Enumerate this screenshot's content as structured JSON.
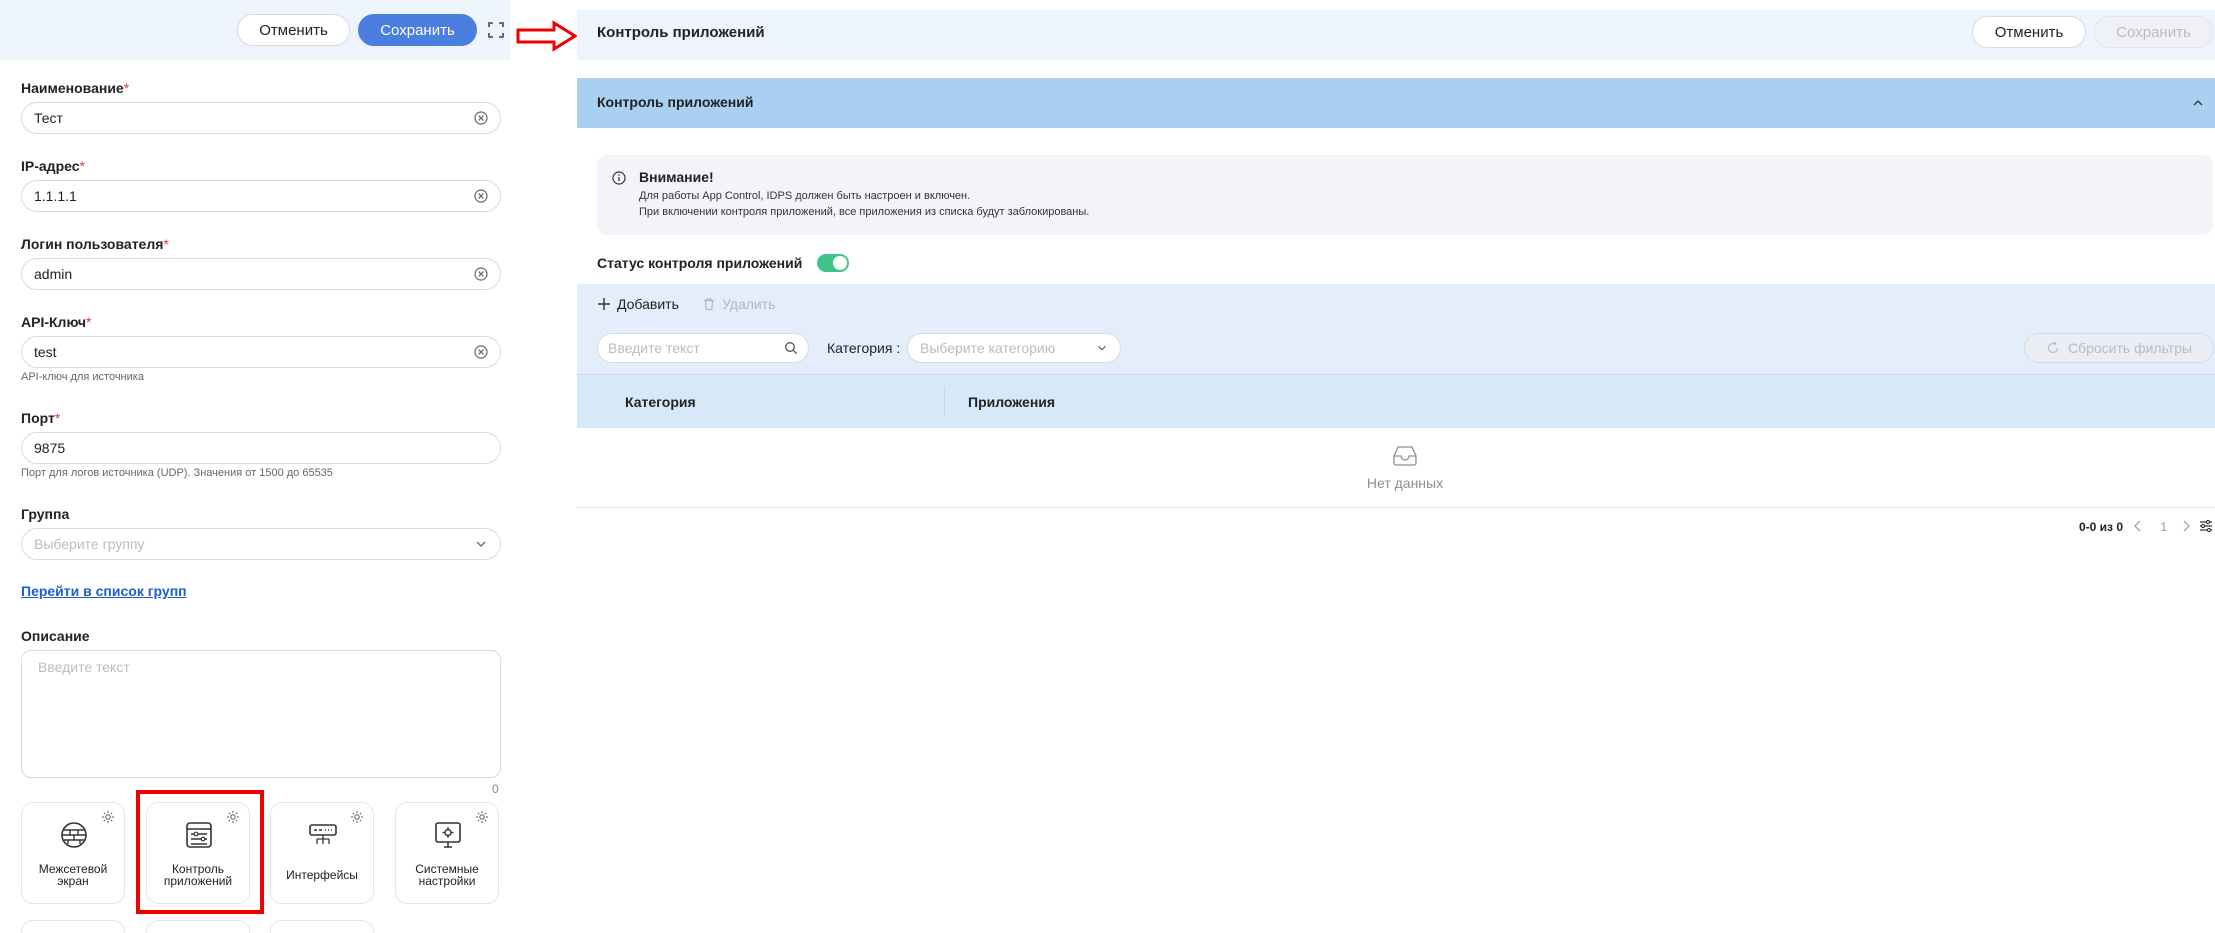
{
  "left_panel": {
    "cancel_label": "Отменить",
    "save_label": "Сохранить",
    "fields": {
      "name": {
        "label": "Наименование",
        "value": "Тест"
      },
      "ip": {
        "label": "IP-адрес",
        "value": "1.1.1.1"
      },
      "login": {
        "label": "Логин пользователя",
        "value": "admin"
      },
      "api_key": {
        "label": "API-Ключ",
        "value": "test",
        "hint": "API-ключ для источника"
      },
      "port": {
        "label": "Порт",
        "value": "9875",
        "hint": "Порт для логов источника (UDP). Значения от 1500 до 65535"
      },
      "group": {
        "label": "Группа",
        "placeholder": "Выберите группу"
      }
    },
    "required_mark": "*",
    "group_link": "Перейти в список групп",
    "description": {
      "label": "Описание",
      "placeholder": "Введите текст",
      "counter": "0"
    },
    "cards": [
      {
        "label": "Межсетевой экран",
        "icon": "firewall-icon"
      },
      {
        "label": "Контроль приложений",
        "icon": "app-control-icon"
      },
      {
        "label": "Интерфейсы",
        "icon": "interfaces-icon"
      },
      {
        "label": "Системные настройки",
        "icon": "system-settings-icon"
      }
    ]
  },
  "right_panel": {
    "title": "Контроль приложений",
    "cancel_label": "Отменить",
    "save_label": "Сохранить",
    "section_title": "Контроль приложений",
    "alert": {
      "title": "Внимание!",
      "line1": "Для работы App Control, IDPS должен быть настроен и включен.",
      "line2": "При включении контроля приложений, все приложения из списка будут заблокированы."
    },
    "status_label": "Статус контроля приложений",
    "status_enabled": true,
    "toolbar": {
      "add_label": "Добавить",
      "delete_label": "Удалить"
    },
    "filters": {
      "search_placeholder": "Введите текст",
      "category_label": "Категория :",
      "category_placeholder": "Выберите категорию",
      "reset_label": "Сбросить фильтры"
    },
    "table": {
      "columns": [
        "Категория",
        "Приложения"
      ],
      "empty_text": "Нет данных"
    },
    "pagination": {
      "info": "0-0 из 0",
      "page": "1"
    }
  },
  "colors": {
    "primary": "#4a7fe0",
    "toggle_on": "#3fc48a",
    "highlight": "#ee0000",
    "section_bar": "#a9d0f0"
  }
}
